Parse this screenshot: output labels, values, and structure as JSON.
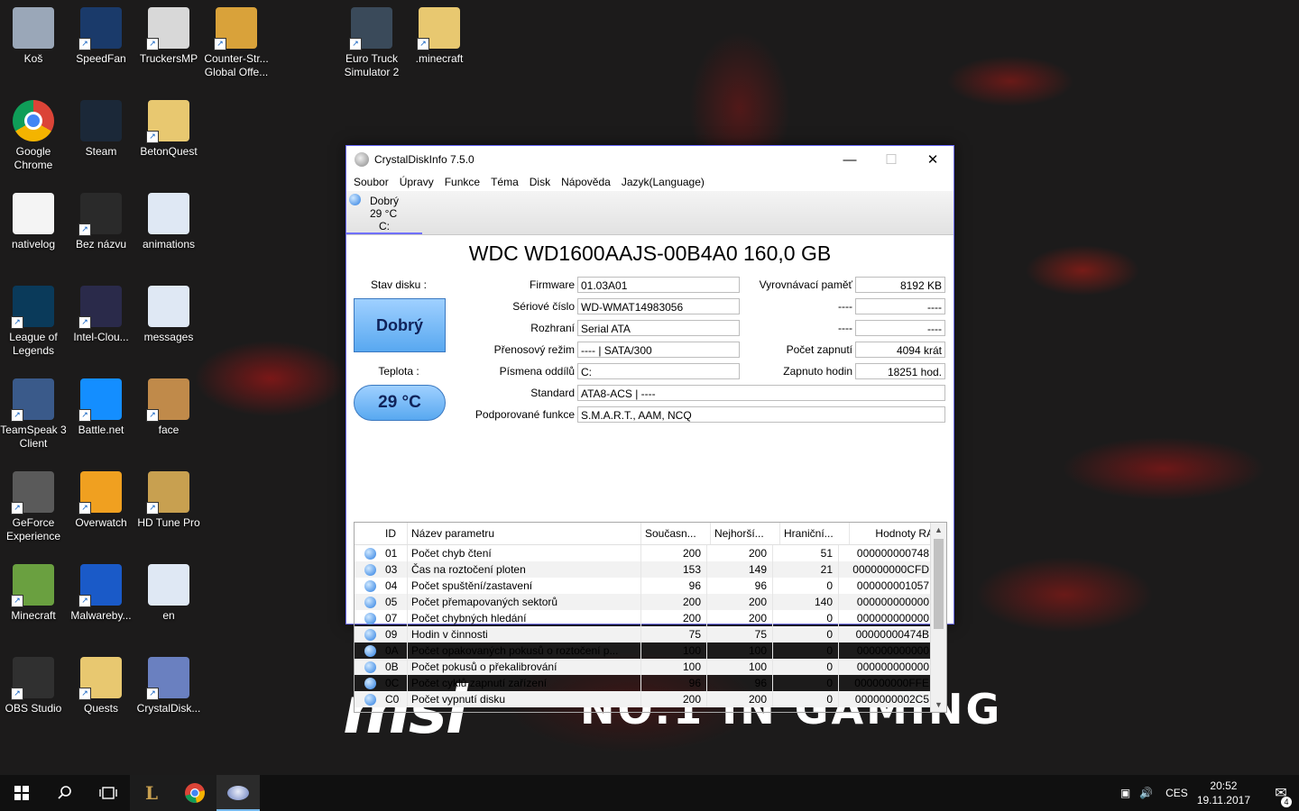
{
  "desktop": {
    "icons": [
      {
        "label": "Koš",
        "icon": "recycle-bin-icon",
        "color": "#9aa7b8",
        "x": 0,
        "y": 0
      },
      {
        "label": "SpeedFan",
        "icon": "speedfan-icon",
        "color": "#1a3a6a",
        "x": 1,
        "y": 0
      },
      {
        "label": "TruckersMP",
        "icon": "truckersmp-icon",
        "color": "#d8d8d8",
        "x": 2,
        "y": 0
      },
      {
        "label": "Counter-Str... Global Offe...",
        "icon": "csgo-icon",
        "color": "#d9a23a",
        "x": 3,
        "y": 0
      },
      {
        "label": "Euro Truck Simulator 2",
        "icon": "truck-icon",
        "color": "#3a4a5a",
        "x": 5,
        "y": 0
      },
      {
        "label": ".minecraft",
        "icon": "folder-icon",
        "color": "#e8c870",
        "x": 6,
        "y": 0
      },
      {
        "label": "Google Chrome",
        "icon": "chrome-icon",
        "color": "#34a853",
        "x": 0,
        "y": 1
      },
      {
        "label": "Steam",
        "icon": "steam-icon",
        "color": "#1b2838",
        "x": 1,
        "y": 1
      },
      {
        "label": "BetonQuest",
        "icon": "folder-icon",
        "color": "#e8c870",
        "x": 2,
        "y": 1
      },
      {
        "label": "nativelog",
        "icon": "text-file-icon",
        "color": "#f4f4f4",
        "x": 0,
        "y": 2
      },
      {
        "label": "Bez názvu",
        "icon": "image-file-icon",
        "color": "#2a2a2a",
        "x": 1,
        "y": 2
      },
      {
        "label": "animations",
        "icon": "wordpad-icon",
        "color": "#dfe8f4",
        "x": 2,
        "y": 2
      },
      {
        "label": "League of Legends",
        "icon": "lol-icon",
        "color": "#0a3a5a",
        "x": 0,
        "y": 3
      },
      {
        "label": "Intel-Clou...",
        "icon": "intel-icon",
        "color": "#2a2a4a",
        "x": 1,
        "y": 3
      },
      {
        "label": "messages",
        "icon": "wordpad-icon",
        "color": "#dfe8f4",
        "x": 2,
        "y": 3
      },
      {
        "label": "TeamSpeak 3 Client",
        "icon": "teamspeak-icon",
        "color": "#3a5a8a",
        "x": 0,
        "y": 4
      },
      {
        "label": "Battle.net",
        "icon": "battlenet-icon",
        "color": "#148eff",
        "x": 1,
        "y": 4
      },
      {
        "label": "face",
        "icon": "face-image-icon",
        "color": "#c08a4a",
        "x": 2,
        "y": 4
      },
      {
        "label": "GeForce Experience",
        "icon": "geforce-icon",
        "color": "#5a5a5a",
        "x": 0,
        "y": 5
      },
      {
        "label": "Overwatch",
        "icon": "overwatch-icon",
        "color": "#f0a020",
        "x": 1,
        "y": 5
      },
      {
        "label": "HD Tune Pro",
        "icon": "hdtune-icon",
        "color": "#c8a050",
        "x": 2,
        "y": 5
      },
      {
        "label": "Minecraft",
        "icon": "minecraft-icon",
        "color": "#6aa040",
        "x": 0,
        "y": 6
      },
      {
        "label": "Malwareby...",
        "icon": "malwarebytes-icon",
        "color": "#1a5ac8",
        "x": 1,
        "y": 6
      },
      {
        "label": "en",
        "icon": "wordpad-icon",
        "color": "#dfe8f4",
        "x": 2,
        "y": 6
      },
      {
        "label": "OBS Studio",
        "icon": "obs-icon",
        "color": "#303030",
        "x": 0,
        "y": 7
      },
      {
        "label": "Quests",
        "icon": "folder-icon",
        "color": "#e8c870",
        "x": 1,
        "y": 7
      },
      {
        "label": "CrystalDisk...",
        "icon": "crystaldisk-icon",
        "color": "#6a80c0",
        "x": 2,
        "y": 7
      }
    ],
    "brand_left": "msi",
    "brand_right": "NO.1 IN GAMING"
  },
  "window": {
    "title": "CrystalDiskInfo 7.5.0",
    "menu": [
      "Soubor",
      "Úpravy",
      "Funkce",
      "Téma",
      "Disk",
      "Nápověda",
      "Jazyk(Language)"
    ],
    "disk_tab": {
      "status": "Dobrý",
      "temp": "29 °C",
      "letter": "C:"
    },
    "model": "WDC WD1600AAJS-00B4A0 160,0 GB",
    "status_label": "Stav disku :",
    "status_value": "Dobrý",
    "temp_label": "Teplota :",
    "temp_value": "29 °C",
    "fields": {
      "firmware_label": "Firmware",
      "firmware": "01.03A01",
      "serial_label": "Sériové číslo",
      "serial": "WD-WMAT14983056",
      "interface_label": "Rozhraní",
      "interface": "Serial ATA",
      "transfer_label": "Přenosový režim",
      "transfer": "---- | SATA/300",
      "drive_letter_label": "Písmena oddílů",
      "drive_letter": "C:",
      "standard_label": "Standard",
      "standard": "ATA8-ACS | ----",
      "features_label": "Podporované funkce",
      "features": "S.M.A.R.T., AAM, NCQ",
      "buffer_label": "Vyrovnávací paměť",
      "buffer": "8192 KB",
      "blank1_label": "----",
      "blank1": "----",
      "blank2_label": "----",
      "blank2": "----",
      "power_count_label": "Počet zapnutí",
      "power_count": "4094 krát",
      "power_hours_label": "Zapnuto hodin",
      "power_hours": "18251 hod."
    },
    "table": {
      "headers": [
        "ID",
        "Název parametru",
        "Současn...",
        "Nejhorší...",
        "Hraniční...",
        "Hodnoty RAW"
      ],
      "rows": [
        [
          "01",
          "Počet chyb čtení",
          "200",
          "200",
          "51",
          "000000000748"
        ],
        [
          "03",
          "Čas na roztočení ploten",
          "153",
          "149",
          "21",
          "000000000CFD"
        ],
        [
          "04",
          "Počet spuštění/zastavení",
          "96",
          "96",
          "0",
          "000000001057"
        ],
        [
          "05",
          "Počet přemapovaných sektorů",
          "200",
          "200",
          "140",
          "000000000000"
        ],
        [
          "07",
          "Počet chybných hledání",
          "200",
          "200",
          "0",
          "000000000000"
        ],
        [
          "09",
          "Hodin v činnosti",
          "75",
          "75",
          "0",
          "00000000474B"
        ],
        [
          "0A",
          "Počet opakovaných pokusů o roztočení p...",
          "100",
          "100",
          "0",
          "000000000000"
        ],
        [
          "0B",
          "Počet pokusů o překalibrování",
          "100",
          "100",
          "0",
          "000000000000"
        ],
        [
          "0C",
          "Počet cyklů zapnutí zařízení",
          "96",
          "96",
          "0",
          "000000000FFE"
        ],
        [
          "C0",
          "Počet vypnutí disku",
          "200",
          "200",
          "0",
          "0000000002C5"
        ]
      ]
    }
  },
  "taskbar": {
    "language": "CES",
    "time": "20:52",
    "date": "19.11.2017",
    "notifications": "4"
  }
}
